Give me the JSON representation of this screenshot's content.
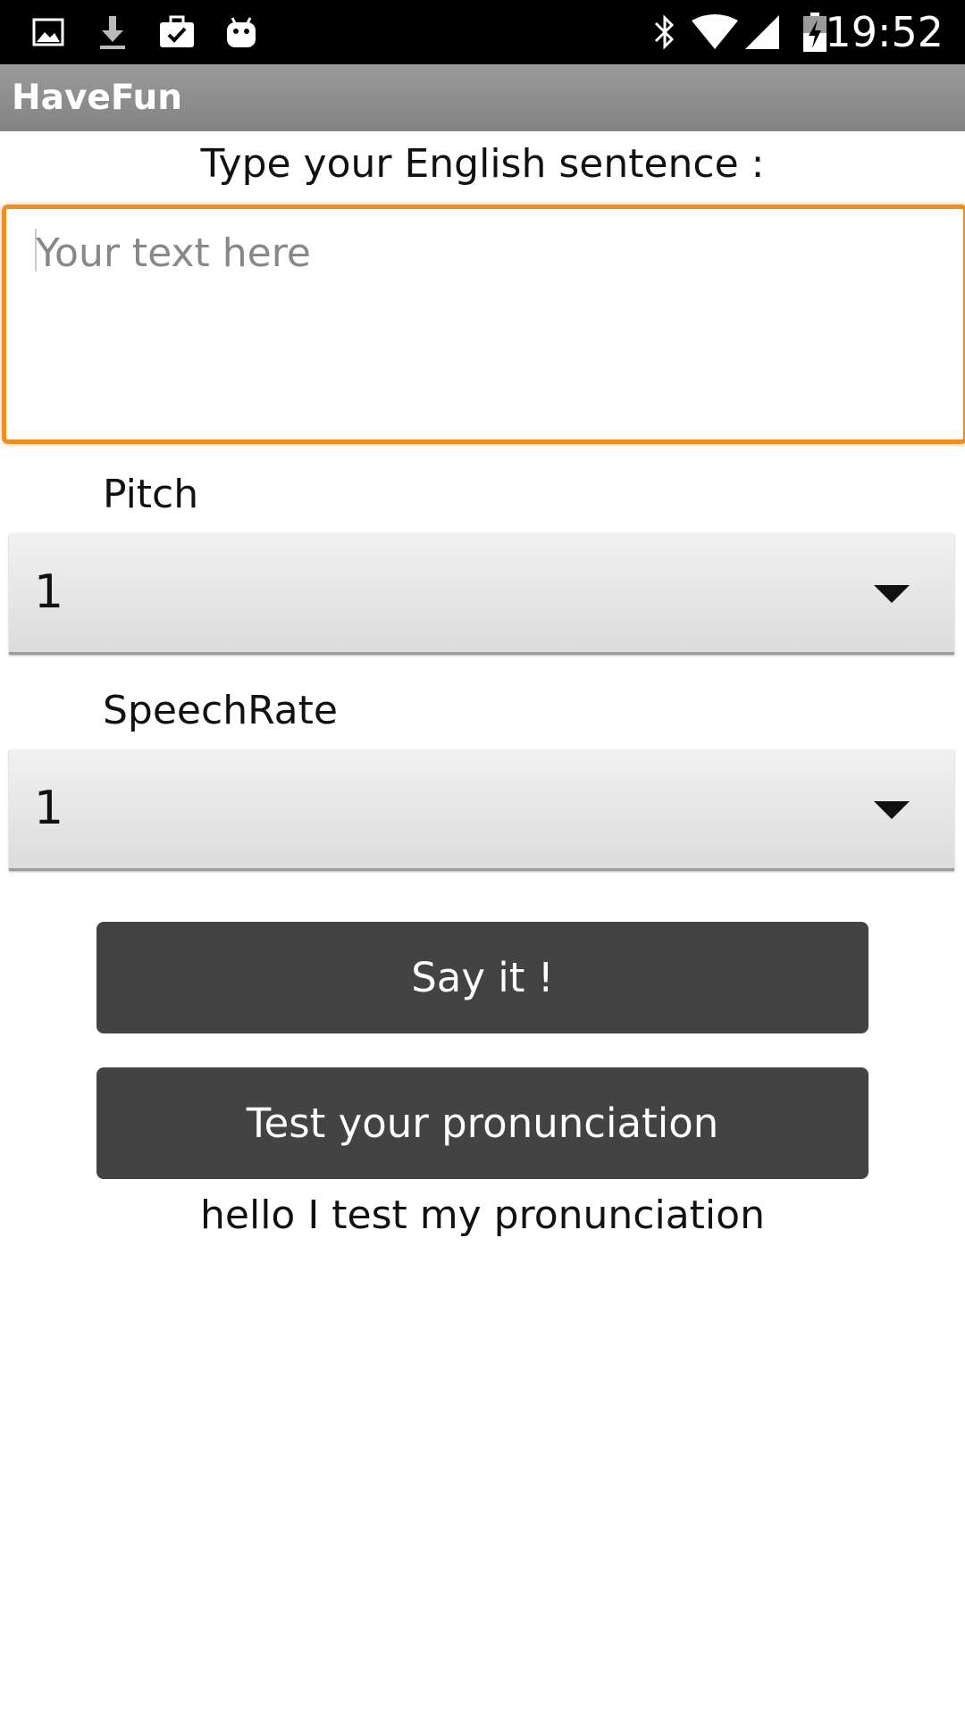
{
  "status_bar": {
    "time": "19:52",
    "left_icons": [
      "image-icon",
      "download-icon",
      "briefcase-check-icon",
      "android-icon"
    ],
    "right_icons": [
      "bluetooth-icon",
      "wifi-icon",
      "signal-icon",
      "battery-charging-icon"
    ]
  },
  "action_bar": {
    "title": "HaveFun"
  },
  "main": {
    "prompt_label": "Type your English sentence :",
    "text_input": {
      "placeholder": "Your text here",
      "value": ""
    },
    "pitch": {
      "label": "Pitch",
      "selected": "1"
    },
    "speech_rate": {
      "label": "SpeechRate",
      "selected": "1"
    },
    "say_button_label": "Say it !",
    "test_button_label": "Test your pronunciation",
    "result_text": "hello I test my pronunciation"
  },
  "colors": {
    "status_bar_bg": "#000000",
    "action_bar_bg": "#8f8f8f",
    "input_focus_border": "#f28c1f",
    "button_bg": "#434343",
    "button_text": "#ffffff"
  }
}
